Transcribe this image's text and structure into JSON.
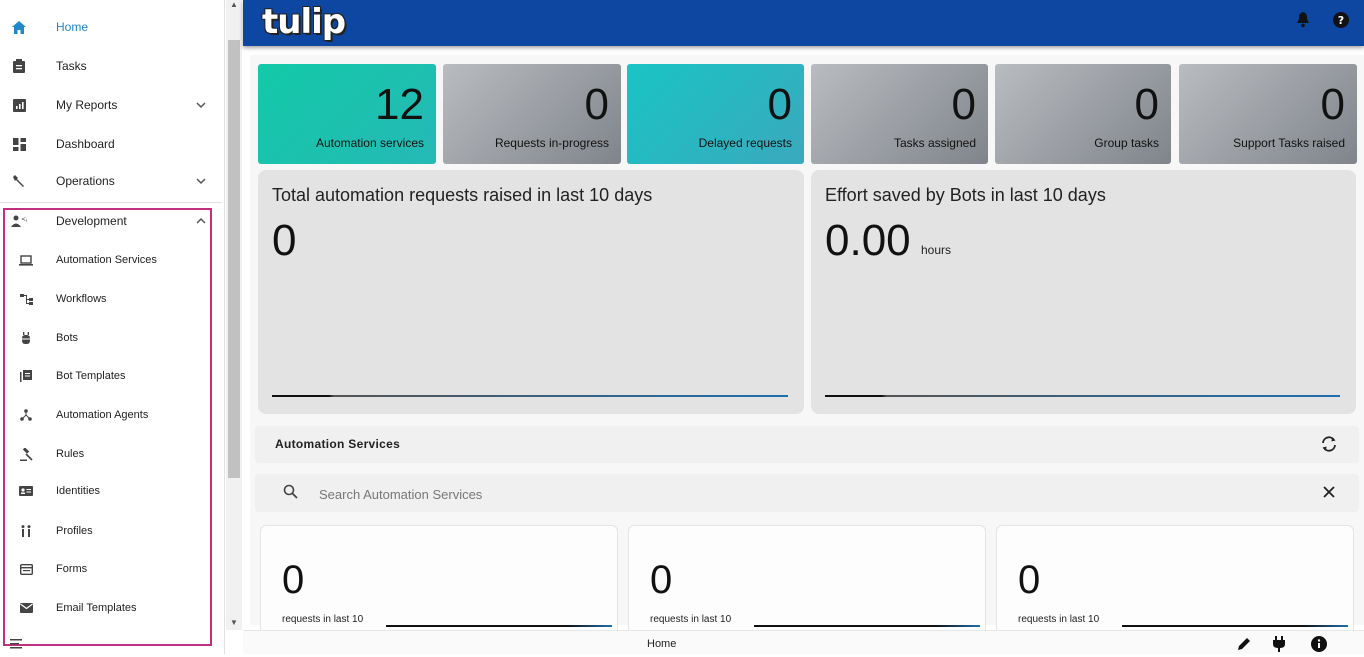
{
  "app": {
    "logo_text": "tulip",
    "footer_label": "Home"
  },
  "sidebar": {
    "items": [
      {
        "label": "Home",
        "icon": "home-icon",
        "active": true
      },
      {
        "label": "Tasks",
        "icon": "clipboard-icon"
      },
      {
        "label": "My Reports",
        "icon": "report-icon",
        "expandable": true
      },
      {
        "label": "Dashboard",
        "icon": "dashboard-icon"
      },
      {
        "label": "Operations",
        "icon": "wrench-icon",
        "expandable": true
      },
      {
        "label": "Development",
        "icon": "developer-icon",
        "expanded": true
      }
    ],
    "development_items": [
      {
        "label": "Automation Services",
        "icon": "laptop-icon"
      },
      {
        "label": "Workflows",
        "icon": "workflow-icon"
      },
      {
        "label": "Bots",
        "icon": "bot-icon"
      },
      {
        "label": "Bot Templates",
        "icon": "library-icon"
      },
      {
        "label": "Automation Agents",
        "icon": "hub-icon"
      },
      {
        "label": "Rules",
        "icon": "gavel-icon"
      },
      {
        "label": "Identities",
        "icon": "id-card-icon"
      },
      {
        "label": "Profiles",
        "icon": "people-icon"
      },
      {
        "label": "Forms",
        "icon": "form-icon"
      },
      {
        "label": "Email Templates",
        "icon": "mail-icon"
      }
    ]
  },
  "stats": [
    {
      "value": "12",
      "label": "Automation services",
      "style": "teal"
    },
    {
      "value": "0",
      "label": "Requests in-progress",
      "style": "grey"
    },
    {
      "value": "0",
      "label": "Delayed requests",
      "style": "teal"
    },
    {
      "value": "0",
      "label": "Tasks assigned",
      "style": "grey"
    },
    {
      "value": "0",
      "label": "Group tasks",
      "style": "grey"
    },
    {
      "value": "0",
      "label": "Support Tasks raised",
      "style": "grey"
    }
  ],
  "panels": {
    "requests": {
      "title": "Total automation requests raised in last 10 days",
      "value": "0"
    },
    "effort": {
      "title": "Effort saved by Bots in last 10 days",
      "value": "0.00",
      "unit": "hours"
    }
  },
  "services": {
    "title": "Automation Services",
    "search_placeholder": "Search Automation Services",
    "cards": [
      {
        "value": "0",
        "caption": "requests in last 10"
      },
      {
        "value": "0",
        "caption": "requests in last 10"
      },
      {
        "value": "0",
        "caption": "requests in last 10"
      }
    ]
  },
  "colors": {
    "topbar": "#0d47a1",
    "active": "#1e88c9",
    "highlight": "#c2307f",
    "teal": "#13c9a7",
    "grey": "#80858b"
  }
}
